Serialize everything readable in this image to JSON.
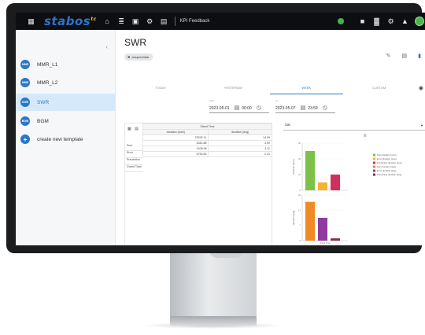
{
  "app": {
    "logo": "stabos",
    "logo_sup": "tc",
    "page_title": "KPI Feedback"
  },
  "sidebar": {
    "items": [
      {
        "badge": "MMR",
        "label": "MMR_L1"
      },
      {
        "badge": "MMR",
        "label": "MMR_L2"
      },
      {
        "badge": "SWR",
        "label": "SWR"
      },
      {
        "badge": "BGM",
        "label": "BGM"
      },
      {
        "badge": "+",
        "label": "create new template"
      }
    ]
  },
  "main": {
    "title": "SWR",
    "chip": "ansprechbar",
    "tabs": [
      "TODAY",
      "YESTERDAY",
      "WEEK",
      "CUSTOM"
    ],
    "from": {
      "label": "from",
      "date": "2023-05-01",
      "time": "00:00"
    },
    "to": {
      "label": "to",
      "date": "2023-05-07",
      "time": "23:59"
    },
    "select_value": "Sat"
  },
  "table": {
    "group_header": "Stand Time",
    "cols": [
      "duration (sum)",
      "duration (avg)"
    ],
    "rows": [
      {
        "name": "Sum",
        "sum": "23232.11",
        "avg": "14.09"
      },
      {
        "name": "Error",
        "sum": "1642.88",
        "avg": "4.90"
      },
      {
        "name": "Preventive",
        "sum": "1108.98",
        "avg": "3.11"
      },
      {
        "name": "Grand Total",
        "sum": "5734.65",
        "avg": "2.31"
      }
    ]
  },
  "chart_data": {
    "type": "bar",
    "panels": [
      {
        "ylabel": "duration (sum)",
        "ylim": [
          0,
          30
        ],
        "series": [
          {
            "name": "Sum duration (sum)",
            "color": "#7dc14a",
            "values": [
              25
            ]
          },
          {
            "name": "Error duration (sum)",
            "color": "#f2b233",
            "values": [
              5
            ]
          },
          {
            "name": "Preventive duration (sum)",
            "color": "#d12f5d",
            "values": [
              10
            ]
          }
        ]
      },
      {
        "ylabel": "duration (avg)",
        "ylim": [
          0,
          20
        ],
        "series": [
          {
            "name": "Sum duration (avg)",
            "color": "#f08a24",
            "values": [
              17
            ]
          },
          {
            "name": "Error duration (avg)",
            "color": "#8e3a9e",
            "values": [
              10
            ]
          },
          {
            "name": "Preventive duration (avg)",
            "color": "#8a2e46",
            "values": [
              1
            ]
          }
        ]
      }
    ],
    "legend": [
      {
        "label": "Sum duration (sum)",
        "color": "#7dc14a"
      },
      {
        "label": "Error duration (sum)",
        "color": "#f2b233"
      },
      {
        "label": "Preventive duration (sum)",
        "color": "#d12f5d"
      },
      {
        "label": "Sum duration (avg)",
        "color": "#f08a24"
      },
      {
        "label": "Error duration (avg)",
        "color": "#8e3a9e"
      },
      {
        "label": "Preventive duration (avg)",
        "color": "#8a2e46"
      }
    ],
    "xlabel": "Stand Time"
  }
}
